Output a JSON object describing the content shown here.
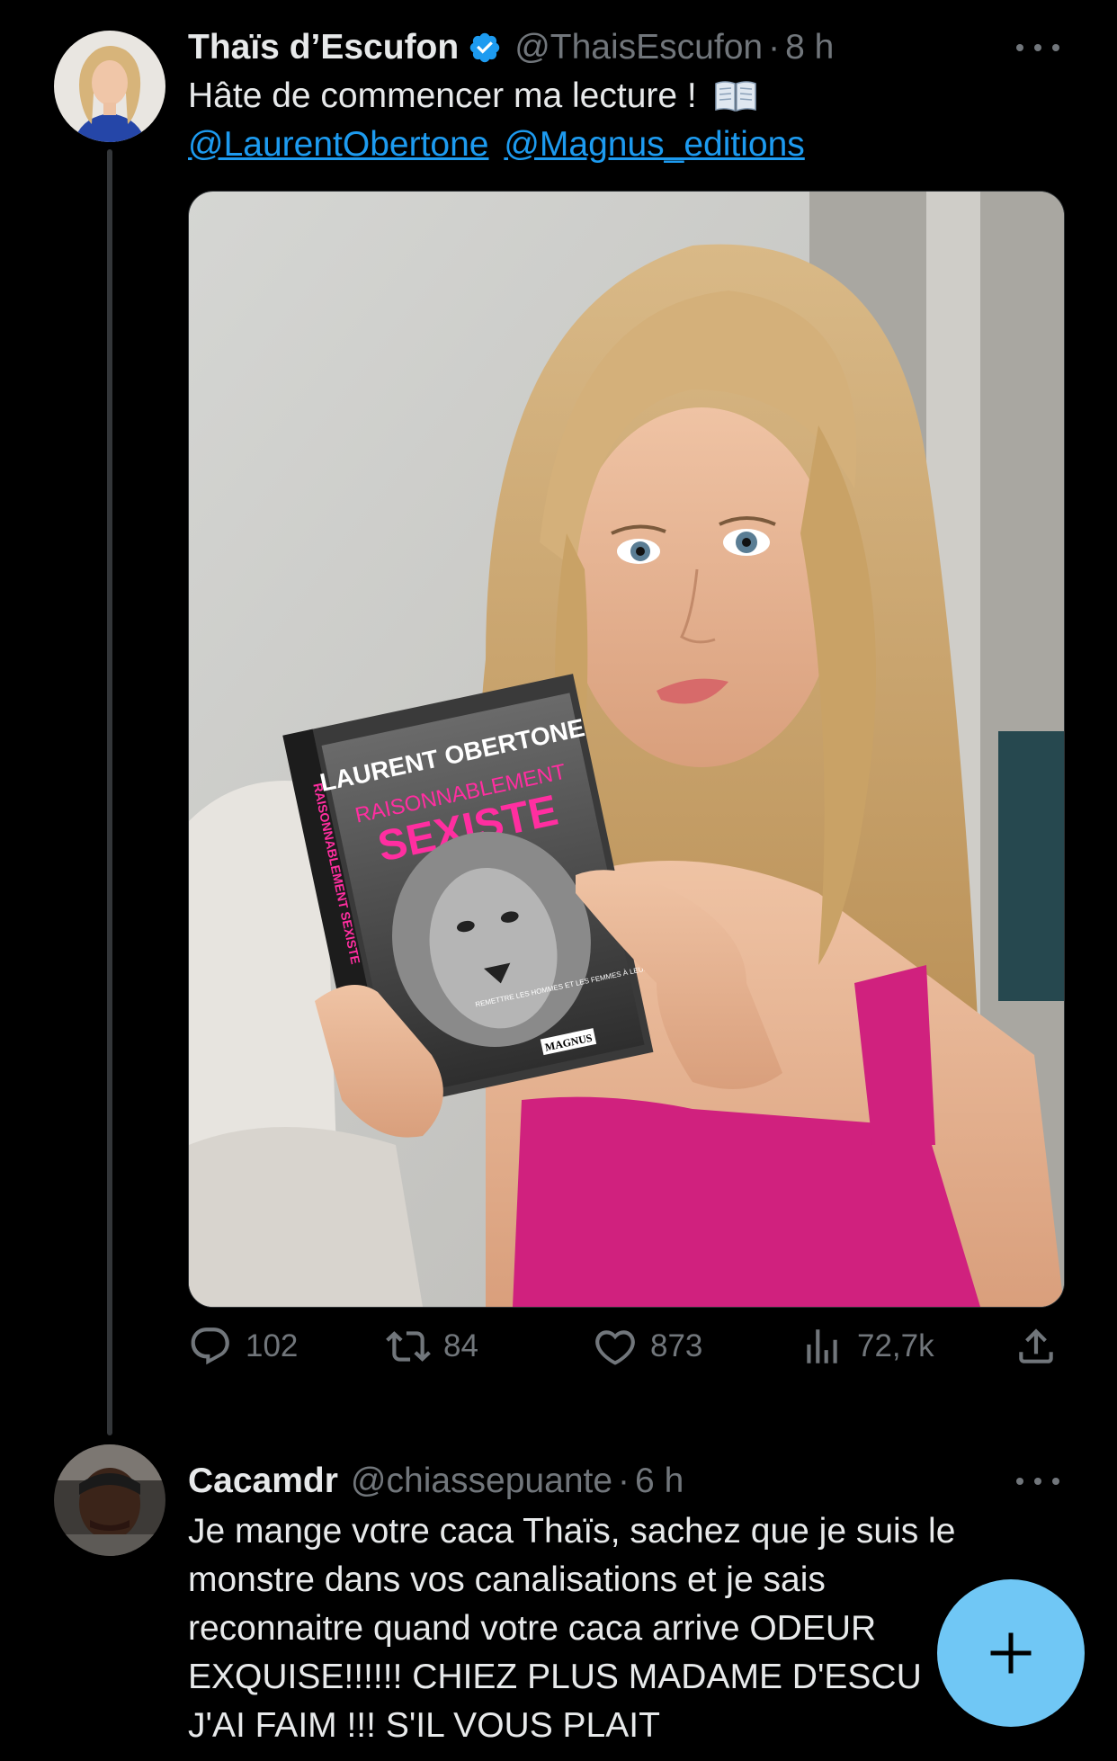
{
  "tweets": [
    {
      "name": "Thaïs d’Escufon",
      "handle": "@ThaisEscufon",
      "dot": "·",
      "time": "8 h",
      "verified": true,
      "text_line1": "Hâte de commencer ma lecture !",
      "emoji": "open-book-icon",
      "mention1": "@LaurentObertone",
      "mention2": "@Magnus_editions",
      "image": {
        "book_author": "LAURENT OBERTONE",
        "book_title_1": "RAISONNABLEMENT",
        "book_title_2": "SEXISTE",
        "book_subtitle": "REMETTRE LES HOMMES ET LES FEMMES À LEUR PLACE",
        "book_publisher": "MAGNUS",
        "book_spine": "RAISONNABLEMENT SEXISTE"
      },
      "replies": "102",
      "retweets": "84",
      "likes": "873",
      "views": "72,7k"
    },
    {
      "name": "Cacamdr",
      "handle": "@chiassepuante",
      "dot": "·",
      "time": "6 h",
      "lines": [
        "Je mange votre caca Thaïs, sachez que je suis le",
        "monstre dans vos canalisations et je sais",
        "reconnaitre quand votre caca arrive ODEUR",
        "EXQUISE!!!!!! CHIEZ PLUS MADAME D'ESCU",
        "J'AI FAIM !!! S'IL VOUS PLAIT"
      ]
    }
  ],
  "colors": {
    "background": "#000000",
    "text": "#e7e9ea",
    "muted": "#71767b",
    "link": "#1d9bf0",
    "fab": "#70c7f5",
    "like_active": "#f91880"
  },
  "fab_icon": "plus-icon"
}
